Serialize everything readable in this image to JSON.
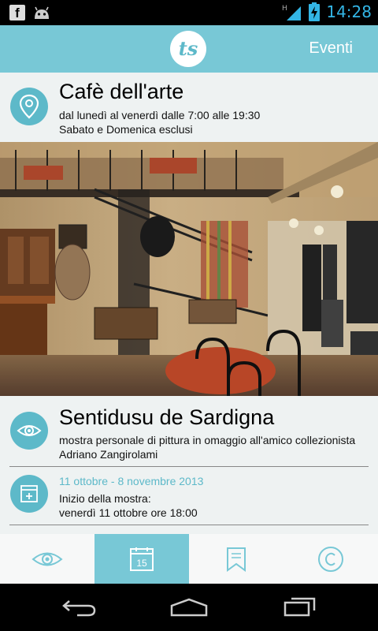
{
  "status_bar": {
    "time": "14:28",
    "icons": [
      "facebook-icon",
      "android-icon",
      "signal-icon",
      "battery-charging-icon"
    ]
  },
  "app_bar": {
    "logo_text": "ts",
    "action_label": "Eventi"
  },
  "venue": {
    "name": "Cafè dell'arte",
    "hours_line1": "dal lunedì al venerdì dalle 7:00 alle 19:30",
    "hours_line2": "Sabato e Domenica esclusi",
    "icon": "location-pin-icon"
  },
  "event": {
    "title": "Sentidusu de Sardigna",
    "description_line1": "mostra personale di pittura in omaggio all'amico collezionista",
    "description_line2": "Adriano Zangirolami",
    "icon": "eye-icon",
    "dates": "11 ottobre - 8 novembre 2013",
    "start_label": "Inizio della mostra:",
    "start_detail": "venerdì 11 ottobre ore 18:00",
    "date_icon": "calendar-plus-icon"
  },
  "tabs": [
    {
      "icon": "eye-icon",
      "active": false
    },
    {
      "icon": "calendar-icon",
      "label": "15",
      "active": true
    },
    {
      "icon": "bookmark-icon",
      "active": false
    },
    {
      "icon": "copyright-icon",
      "active": false
    }
  ],
  "colors": {
    "accent": "#78c8d6",
    "accent_dark": "#5db9c9",
    "panel_bg": "#eef2f2",
    "status_clock": "#33b5e5"
  }
}
